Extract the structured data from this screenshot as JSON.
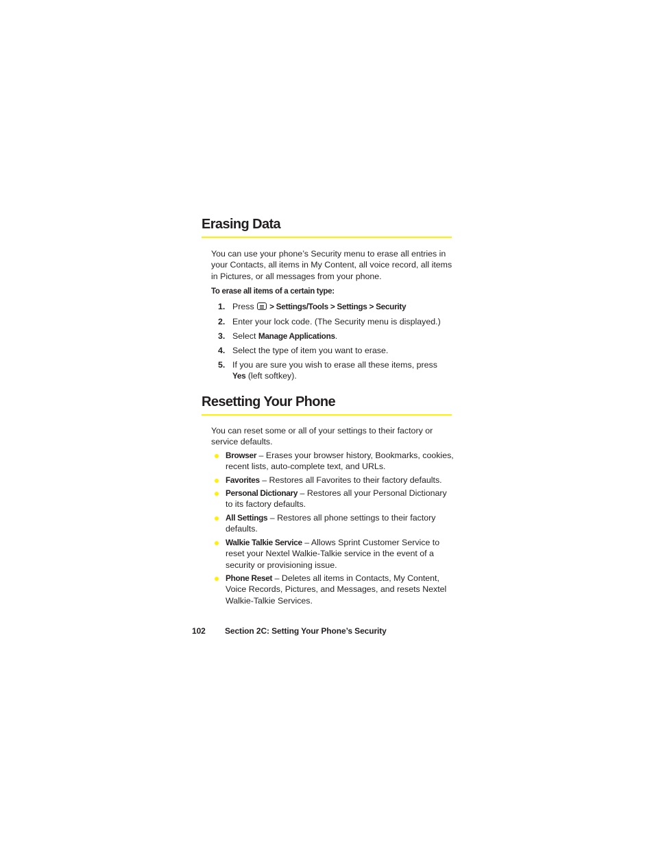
{
  "sections": [
    {
      "title": "Erasing Data",
      "intro": "You can use your phone’s Security menu to erase all entries in your Contacts, all items in My Content, all voice record, all items in Pictures, or all messages from your phone.",
      "procedure_lead": "To erase all items of a certain type:",
      "steps": [
        {
          "num": "1.",
          "pre": "Press ",
          "icon": "menu-key-icon",
          "bold": " > Settings/Tools > Settings > Security",
          "post": ""
        },
        {
          "num": "2.",
          "pre": "Enter your lock code. (The Security menu is displayed.)",
          "bold": "",
          "post": ""
        },
        {
          "num": "3.",
          "pre": "Select ",
          "bold": "Manage Applications",
          "post": "."
        },
        {
          "num": "4.",
          "pre": "Select the type of item you want to erase.",
          "bold": "",
          "post": ""
        },
        {
          "num": "5.",
          "pre": "If you are sure you wish to erase all these items, press ",
          "bold": "Yes",
          "post": " (left softkey)."
        }
      ]
    },
    {
      "title": "Resetting Your Phone",
      "intro": "You can reset some or all of your settings to their factory or service defaults.",
      "bullets": [
        {
          "term": "Browser",
          "desc": " – Erases your browser history, Bookmarks, cookies, recent lists, auto-complete text, and URLs."
        },
        {
          "term": "Favorites",
          "desc": " – Restores all Favorites to their factory defaults."
        },
        {
          "term": "Personal Dictionary",
          "desc": " – Restores all your Personal Dictionary to its factory defaults."
        },
        {
          "term": "All Settings",
          "desc": " – Restores all phone settings to their factory defaults."
        },
        {
          "term": "Walkie Talkie Service",
          "desc": " – Allows Sprint Customer Service to reset your Nextel Walkie-Talkie service in the event of a security or provisioning issue."
        },
        {
          "term": "Phone Reset",
          "desc": " – Deletes all items in Contacts, My Content, Voice Records, Pictures, and Messages, and resets Nextel Walkie-Talkie Services."
        }
      ]
    }
  ],
  "footer": {
    "page_number": "102",
    "section_title": "Section 2C: Setting Your Phone’s Security"
  },
  "colors": {
    "accent": "#fff200",
    "text": "#231f20"
  }
}
